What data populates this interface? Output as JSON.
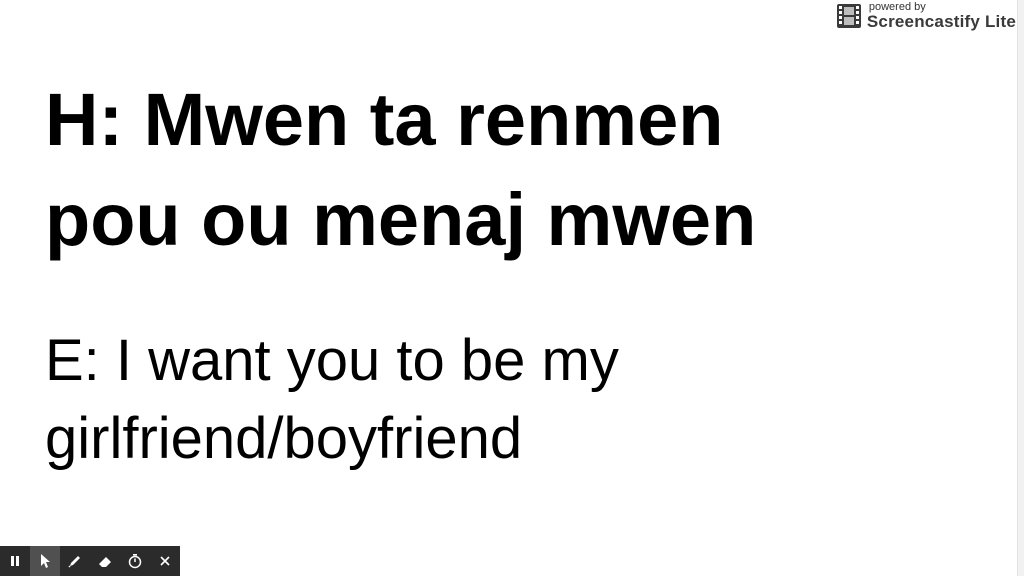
{
  "slide": {
    "heading_lines": [
      "H: Mwen ta renmen",
      "pou ou menaj mwen"
    ],
    "subtext_lines": [
      "E: I want you to be my",
      "girlfriend/boyfriend"
    ]
  },
  "watermark": {
    "powered_by": "powered by",
    "brand": "Screencastify Lite",
    "icon": "film-strip-icon"
  },
  "toolbar": {
    "buttons": [
      {
        "icon": "pause-icon",
        "active": false
      },
      {
        "icon": "cursor-icon",
        "active": true
      },
      {
        "icon": "pen-icon",
        "active": false
      },
      {
        "icon": "eraser-icon",
        "active": false
      },
      {
        "icon": "timer-icon",
        "active": false
      },
      {
        "icon": "close-icon",
        "active": false
      }
    ]
  },
  "colors": {
    "text": "#000000",
    "background": "#ffffff",
    "toolbar_bg": "#2b2b2b",
    "toolbar_active": "#505050",
    "watermark_text": "#3a3a3a"
  }
}
